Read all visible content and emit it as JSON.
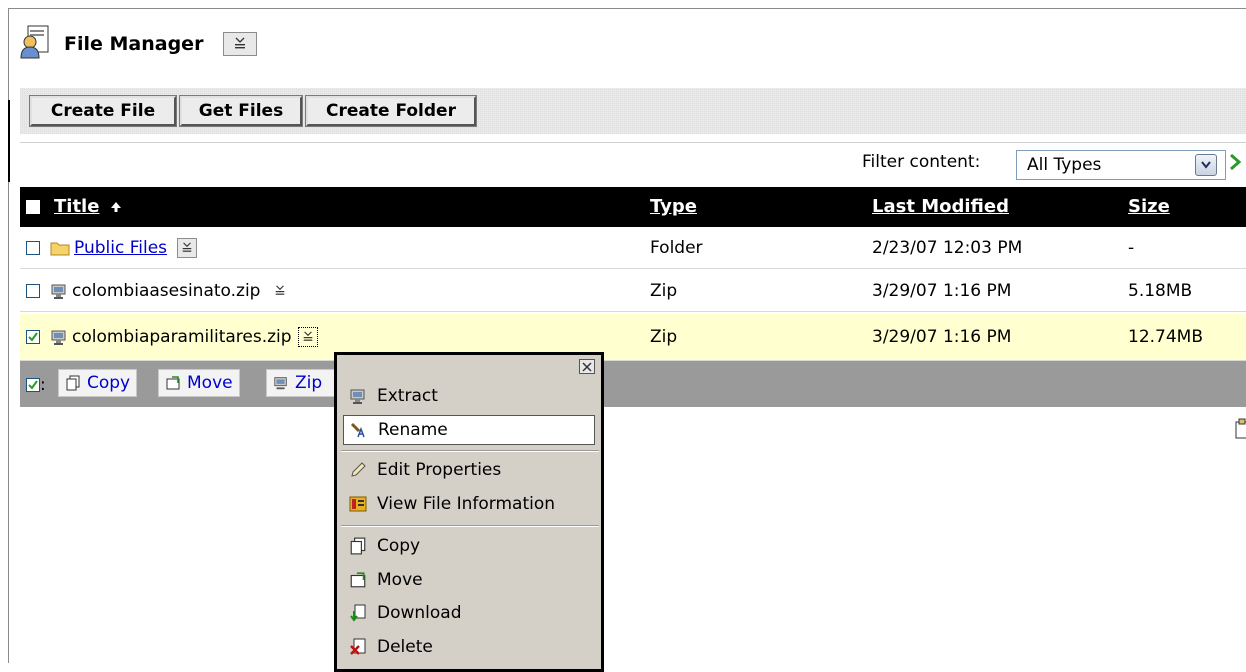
{
  "header": {
    "title": "File Manager"
  },
  "toolbar": {
    "create_file": "Create File",
    "get_files": "Get Files",
    "create_folder": "Create Folder"
  },
  "filter": {
    "label": "Filter content:",
    "selected": "All Types"
  },
  "table": {
    "columns": {
      "title": "Title",
      "type": "Type",
      "last_modified": "Last Modified",
      "size": "Size"
    },
    "rows": [
      {
        "name": "Public Files",
        "type": "Folder",
        "modified": "2/23/07 12:03 PM",
        "size": "-"
      },
      {
        "name": "colombiaasesinato.zip",
        "type": "Zip",
        "modified": "3/29/07 1:16 PM",
        "size": "5.18MB"
      },
      {
        "name": "colombiaparamilitares.zip",
        "type": "Zip",
        "modified": "3/29/07 1:16 PM",
        "size": "12.74MB"
      }
    ]
  },
  "actions": {
    "copy": "Copy",
    "move": "Move",
    "zip": "Zip"
  },
  "context_menu": {
    "items": [
      "Extract",
      "Rename",
      "Edit Properties",
      "View File Information",
      "Copy",
      "Move",
      "Download",
      "Delete"
    ]
  },
  "colors": {
    "header_bg": "#000000",
    "selected_row": "#ffffd0",
    "action_bar": "#9a9a9a",
    "link": "#0000cc"
  }
}
